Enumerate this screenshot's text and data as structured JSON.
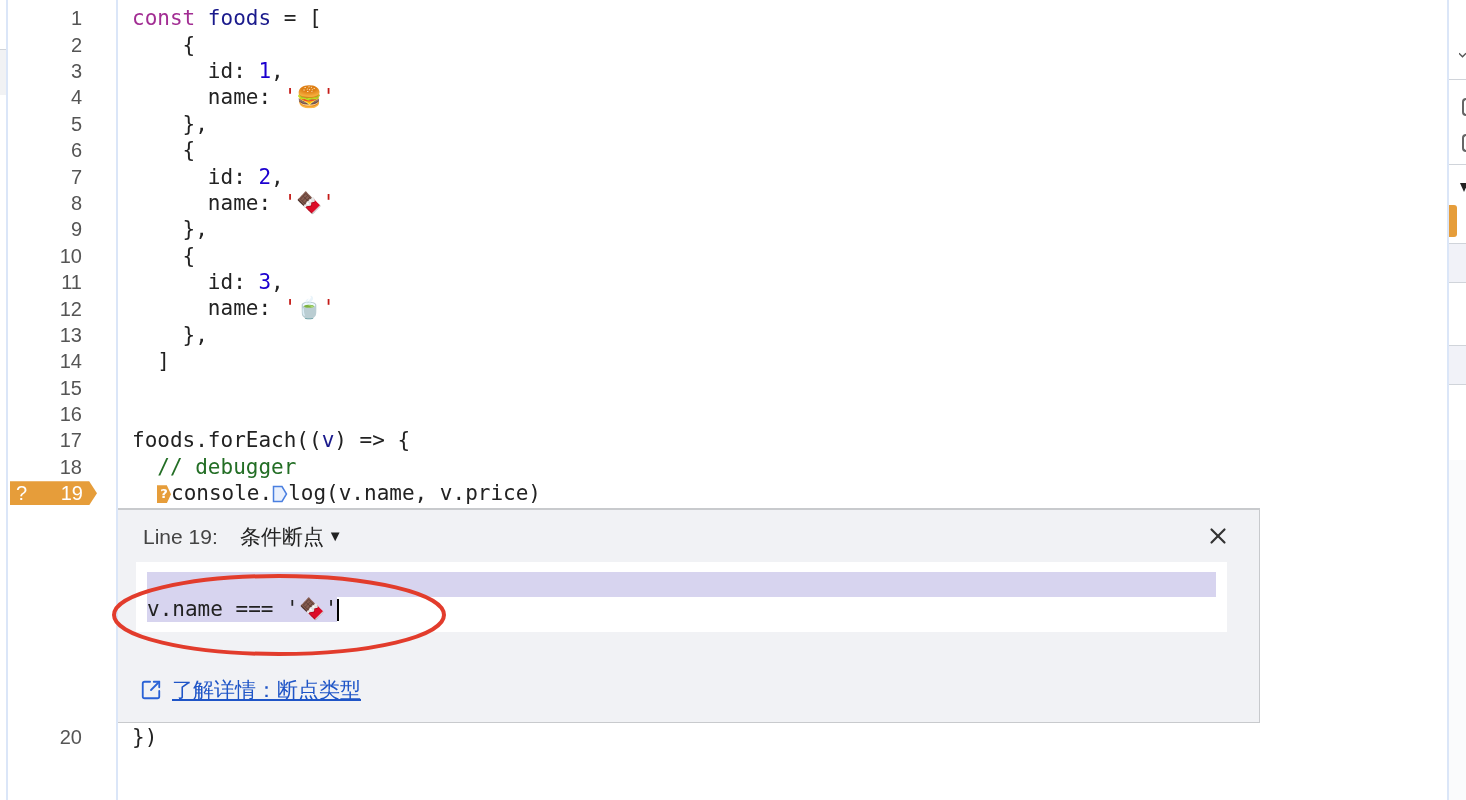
{
  "editor": {
    "lines": [
      {
        "number": "1",
        "tokens": [
          {
            "text": "const ",
            "kind": "keyword"
          },
          {
            "text": "foods",
            "kind": "definition"
          },
          {
            "text": " = [",
            "kind": "plain"
          }
        ]
      },
      {
        "number": "2",
        "tokens": [
          {
            "text": "    {",
            "kind": "plain"
          }
        ]
      },
      {
        "number": "3",
        "tokens": [
          {
            "text": "      id: ",
            "kind": "plain"
          },
          {
            "text": "1",
            "kind": "number"
          },
          {
            "text": ",",
            "kind": "plain"
          }
        ]
      },
      {
        "number": "4",
        "tokens": [
          {
            "text": "      name: ",
            "kind": "plain"
          },
          {
            "text": "'🍔'",
            "kind": "string"
          }
        ]
      },
      {
        "number": "5",
        "tokens": [
          {
            "text": "    },",
            "kind": "plain"
          }
        ]
      },
      {
        "number": "6",
        "tokens": [
          {
            "text": "    {",
            "kind": "plain"
          }
        ]
      },
      {
        "number": "7",
        "tokens": [
          {
            "text": "      id: ",
            "kind": "plain"
          },
          {
            "text": "2",
            "kind": "number"
          },
          {
            "text": ",",
            "kind": "plain"
          }
        ]
      },
      {
        "number": "8",
        "tokens": [
          {
            "text": "      name: ",
            "kind": "plain"
          },
          {
            "text": "'🍫'",
            "kind": "string"
          }
        ]
      },
      {
        "number": "9",
        "tokens": [
          {
            "text": "    },",
            "kind": "plain"
          }
        ]
      },
      {
        "number": "10",
        "tokens": [
          {
            "text": "    {",
            "kind": "plain"
          }
        ]
      },
      {
        "number": "11",
        "tokens": [
          {
            "text": "      id: ",
            "kind": "plain"
          },
          {
            "text": "3",
            "kind": "number"
          },
          {
            "text": ",",
            "kind": "plain"
          }
        ]
      },
      {
        "number": "12",
        "tokens": [
          {
            "text": "      name: ",
            "kind": "plain"
          },
          {
            "text": "'🍵'",
            "kind": "string"
          }
        ]
      },
      {
        "number": "13",
        "tokens": [
          {
            "text": "    },",
            "kind": "plain"
          }
        ]
      },
      {
        "number": "14",
        "tokens": [
          {
            "text": "  ]",
            "kind": "plain"
          }
        ]
      },
      {
        "number": "15"
      },
      {
        "number": "16"
      },
      {
        "number": "17",
        "tokens": [
          {
            "text": "foods.forEach((",
            "kind": "plain"
          },
          {
            "text": "v",
            "kind": "definition"
          },
          {
            "text": ") => {",
            "kind": "plain"
          }
        ]
      },
      {
        "number": "18",
        "tokens": [
          {
            "text": "  // debugger",
            "kind": "comment"
          }
        ]
      },
      {
        "number": "19",
        "breakpoint": {
          "kind": "conditional",
          "marker": "?"
        },
        "tokens": [
          {
            "text": "?",
            "kind": "conditional-marker"
          },
          {
            "text": "console.",
            "kind": "plain"
          },
          {
            "kind": "location-marker"
          },
          {
            "text": "log(v.name, v.price)",
            "kind": "plain"
          }
        ]
      },
      {
        "number": "20",
        "tokens": [
          {
            "text": "})",
            "kind": "plain"
          }
        ]
      }
    ]
  },
  "breakpoint_editor": {
    "title": "Line 19:",
    "type": "条件断点",
    "dropdown_glyph": "▼",
    "condition": {
      "value": "\nv.name === '🍫'",
      "selected": true
    },
    "link": "了解详情：断点类型"
  }
}
